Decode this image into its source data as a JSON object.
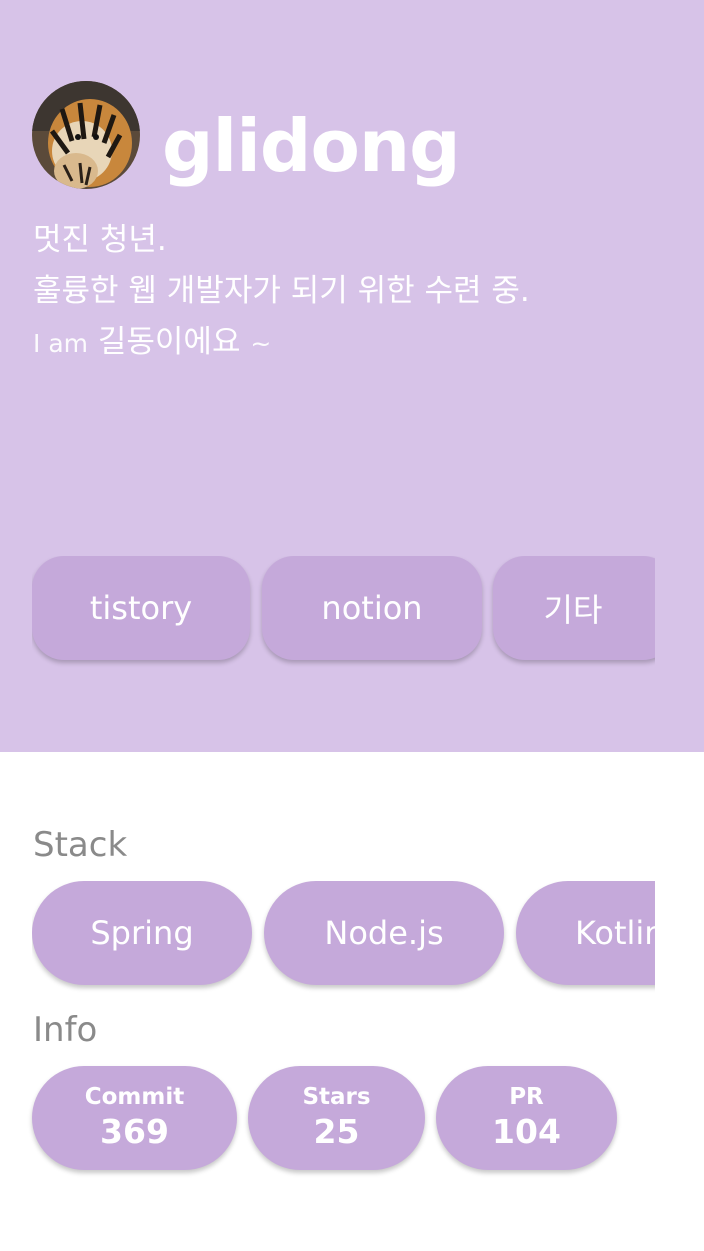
{
  "profile": {
    "username": "glidong",
    "avatar_icon": "tiger-photo",
    "bio": {
      "line1": "멋진 청년.",
      "line2": "훌륭한 웹 개발자가 되기 위한 수련 중.",
      "line3_prefix": "I am",
      "line3_main": "길동이에요",
      "line3_suffix": "~"
    }
  },
  "links": [
    {
      "label": "tistory"
    },
    {
      "label": "notion"
    },
    {
      "label": "기타"
    }
  ],
  "stack": {
    "title": "Stack",
    "items": [
      {
        "label": "Spring"
      },
      {
        "label": "Node.js"
      },
      {
        "label": "Kotlin"
      }
    ]
  },
  "info": {
    "title": "Info",
    "stats": [
      {
        "label": "Commit",
        "value": "369"
      },
      {
        "label": "Stars",
        "value": "25"
      },
      {
        "label": "PR",
        "value": "104"
      }
    ]
  },
  "colors": {
    "header_bg": "#d7c3e8",
    "chip_bg": "#c5a9da",
    "text_on_accent": "#ffffff",
    "section_title": "#8a8a8a"
  }
}
